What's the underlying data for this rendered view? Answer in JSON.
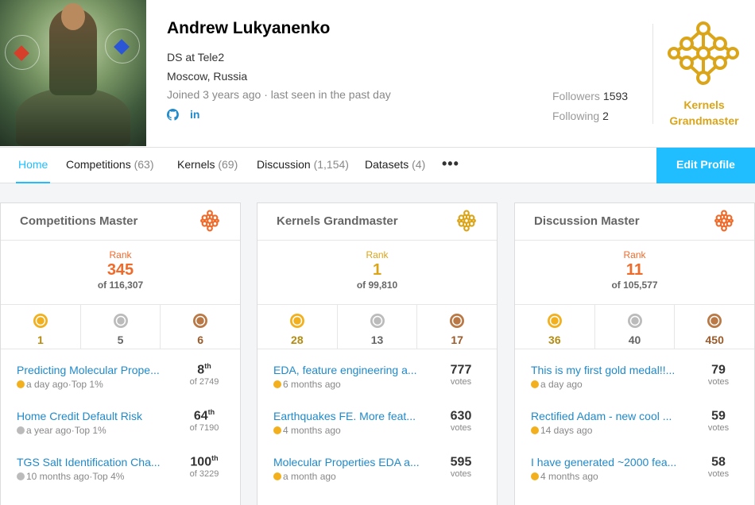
{
  "profile": {
    "name": "Andrew Lukyanenko",
    "occupation": "DS at Tele2",
    "location": "Moscow, Russia",
    "joined": "Joined 3 years ago · last seen in the past day",
    "social": [
      "github-icon",
      "linkedin-icon"
    ],
    "followers_label": "Followers",
    "followers": "1593",
    "following_label": "Following",
    "following": "2",
    "tier_label": "Kernels Grandmaster"
  },
  "nav": {
    "tabs": [
      {
        "label": "Home",
        "count": ""
      },
      {
        "label": "Competitions",
        "count": "(63)"
      },
      {
        "label": "Kernels",
        "count": "(69)"
      },
      {
        "label": "Discussion",
        "count": "(1,154)"
      },
      {
        "label": "Datasets",
        "count": "(4)"
      }
    ],
    "more": "•••",
    "edit": "Edit Profile"
  },
  "colors": {
    "accent": "#20beff",
    "link": "#1f8acb",
    "master": "#f06a2a",
    "grandmaster": "#dba51a",
    "gold": "#f2b01e",
    "silver": "#bbbbbb",
    "bronze": "#b97844"
  },
  "cards": [
    {
      "title": "Competitions Master",
      "tier_color": "#f06a2a",
      "rank_label": "Rank",
      "rank": "345",
      "rank_of": "of 116,307",
      "medals": [
        {
          "type": "gold",
          "count": "1"
        },
        {
          "type": "silver",
          "count": "5"
        },
        {
          "type": "bronze",
          "count": "6"
        }
      ],
      "items": [
        {
          "title": "Predicting Molecular Prope...",
          "meta": "a day ago·Top 1%",
          "medal": "gold",
          "value": "8",
          "suffix": "th",
          "sub": "of 2749"
        },
        {
          "title": "Home Credit Default Risk",
          "meta": "a year ago·Top 1%",
          "medal": "silver",
          "value": "64",
          "suffix": "th",
          "sub": "of 7190"
        },
        {
          "title": "TGS Salt Identification Cha...",
          "meta": "10 months ago·Top 4%",
          "medal": "silver",
          "value": "100",
          "suffix": "th",
          "sub": "of 3229"
        }
      ]
    },
    {
      "title": "Kernels Grandmaster",
      "tier_color": "#dba51a",
      "rank_label": "Rank",
      "rank": "1",
      "rank_of": "of 99,810",
      "medals": [
        {
          "type": "gold",
          "count": "28"
        },
        {
          "type": "silver",
          "count": "13"
        },
        {
          "type": "bronze",
          "count": "17"
        }
      ],
      "items": [
        {
          "title": "EDA, feature engineering a...",
          "meta": "6 months ago",
          "medal": "gold",
          "value": "777",
          "suffix": "",
          "sub": "votes"
        },
        {
          "title": "Earthquakes FE. More feat...",
          "meta": "4 months ago",
          "medal": "gold",
          "value": "630",
          "suffix": "",
          "sub": "votes"
        },
        {
          "title": "Molecular Properties EDA a...",
          "meta": "a month ago",
          "medal": "gold",
          "value": "595",
          "suffix": "",
          "sub": "votes"
        }
      ]
    },
    {
      "title": "Discussion Master",
      "tier_color": "#f06a2a",
      "rank_label": "Rank",
      "rank": "11",
      "rank_of": "of 105,577",
      "medals": [
        {
          "type": "gold",
          "count": "36"
        },
        {
          "type": "silver",
          "count": "40"
        },
        {
          "type": "bronze",
          "count": "450"
        }
      ],
      "items": [
        {
          "title": "This is my first gold medal!!...",
          "meta": "a day ago",
          "medal": "gold",
          "value": "79",
          "suffix": "",
          "sub": "votes"
        },
        {
          "title": "Rectified Adam - new cool ...",
          "meta": "14 days ago",
          "medal": "gold",
          "value": "59",
          "suffix": "",
          "sub": "votes"
        },
        {
          "title": "I have generated ~2000 fea...",
          "meta": "4 months ago",
          "medal": "gold",
          "value": "58",
          "suffix": "",
          "sub": "votes"
        }
      ]
    }
  ]
}
